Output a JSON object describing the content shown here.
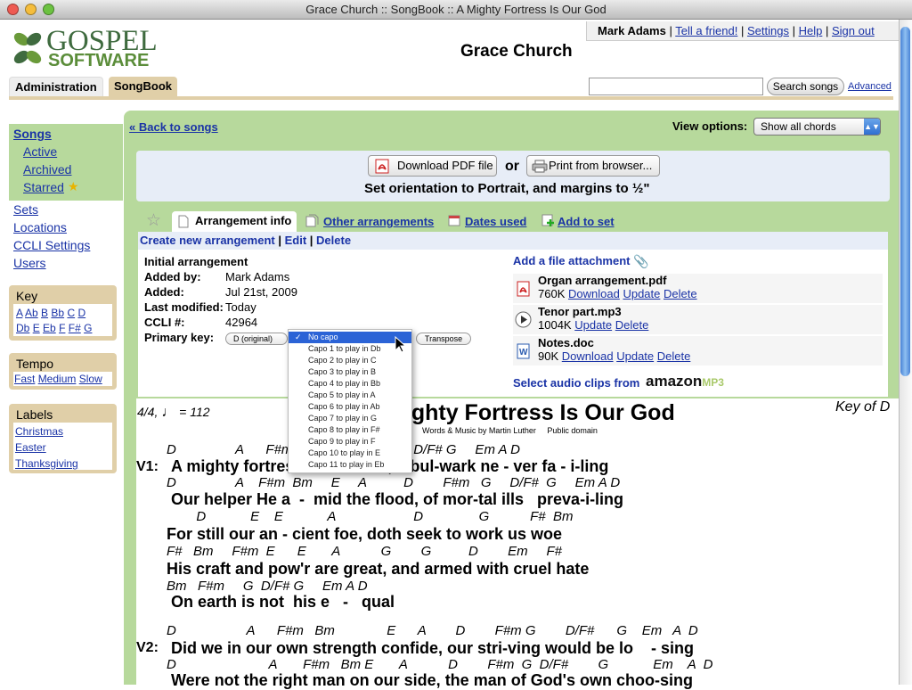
{
  "window": {
    "title": "Grace Church :: SongBook :: A Mighty Fortress Is Our God"
  },
  "logo": {
    "word1": "GOSPEL",
    "word2": "SOFTWARE"
  },
  "usernav": {
    "user": "Mark Adams",
    "links": [
      "Tell a friend!",
      "Settings",
      "Help",
      "Sign out"
    ],
    "sep": "|"
  },
  "church_name": "Grace Church",
  "tabs": {
    "admin": "Administration",
    "songbook": "SongBook"
  },
  "search": {
    "value": "",
    "button": "Search songs",
    "advanced": "Advanced"
  },
  "sidebar": {
    "songs": "Songs",
    "songs_sub": [
      "Active",
      "Archived",
      "Starred"
    ],
    "links": [
      "Sets",
      "Locations",
      "CCLI Settings",
      "Users"
    ],
    "key": {
      "title": "Key",
      "row1": [
        "A",
        "Ab",
        "B",
        "Bb",
        "C",
        "D"
      ],
      "row2": [
        "Db",
        "E",
        "Eb",
        "F",
        "F#",
        "G"
      ]
    },
    "tempo": {
      "title": "Tempo",
      "items": [
        "Fast",
        "Medium",
        "Slow"
      ]
    },
    "labels": {
      "title": "Labels",
      "items": [
        "Christmas",
        "Easter",
        "Thanksgiving"
      ]
    }
  },
  "main": {
    "back": "« Back to songs",
    "view_options_label": "View options:",
    "view_option_value": "Show all chords",
    "download_pdf": "Download PDF file",
    "or": "or",
    "print": "Print from browser...",
    "orientation": "Set orientation to Portrait, and margins to ½\"",
    "tabs": [
      "Arrangement info",
      "Other arrangements",
      "Dates used",
      "Add to set"
    ],
    "actions": [
      "Create new arrangement",
      "Edit",
      "Delete"
    ],
    "info": {
      "title": "Initial arrangement",
      "added_by_label": "Added by:",
      "added_by": "Mark Adams",
      "added_label": "Added:",
      "added": "Jul 21st, 2009",
      "modified_label": "Last modified:",
      "modified": "Today",
      "ccli_label": "CCLI #:",
      "ccli": "42964",
      "key_label": "Primary key:",
      "key_value": "D (original)",
      "transpose": "Transpose"
    },
    "capo_options": [
      "No capo",
      "Capo 1 to play in Db",
      "Capo 2 to play in C",
      "Capo 3 to play in B",
      "Capo 4 to play in Bb",
      "Capo 5 to play in A",
      "Capo 6 to play in Ab",
      "Capo 7 to play in G",
      "Capo 8 to play in F#",
      "Capo 9 to play in F",
      "Capo 10 to play in E",
      "Capo 11 to play in Eb"
    ],
    "attachments": {
      "add": "Add a file attachment",
      "files": [
        {
          "name": "Organ arrangement.pdf",
          "size": "760K",
          "links": [
            "Download",
            "Update",
            "Delete"
          ]
        },
        {
          "name": "Tenor part.mp3",
          "size": "1004K",
          "links": [
            "Update",
            "Delete"
          ]
        },
        {
          "name": "Notes.doc",
          "size": "90K",
          "links": [
            "Download",
            "Update",
            "Delete"
          ]
        }
      ],
      "audio": "Select audio clips from",
      "amazon": "amazon",
      "mp3": "MP3"
    }
  },
  "song": {
    "tempo": "4/4,",
    "bpm": "= 112",
    "title": "A Mighty Fortress Is Our God",
    "credits": "Words & Music by Martin Luther",
    "rights": "Public domain",
    "key": "Key of D",
    "v1": "V1:",
    "v2": "V2:",
    "lines": [
      {
        "chords": "D                A      F#m           D F#m G       D/F# G     Em A D",
        "lyric": "A mighty fortress is our God, a bul-wark ne - ver fa - i-ling"
      },
      {
        "chords": "D                A    F#m  Bm     E     A          D        F#m   G     D/F#  G     Em A D",
        "lyric": "Our helper He a  -  mid the flood, of mor-tal ills   preva-i-ling"
      },
      {
        "chords": "        D            E    E            A                     D               G           F#  Bm",
        "lyric": "For still our an - cient foe, doth seek to work us woe"
      },
      {
        "chords": "F#   Bm     F#m  E      E       A           G        G          D        Em     F#",
        "lyric": "His craft and pow'r are great, and armed with cruel hate"
      },
      {
        "chords": "Bm   F#m     G  D/F# G     Em A D",
        "lyric": "On earth is not  his e   -   qual"
      },
      {
        "chords": "D                   A      F#m   Bm              E      A        D        F#m G        D/F#      G    Em   A  D",
        "lyric": "Did we in our own strength confide, our stri-ving would be lo    - sing"
      },
      {
        "chords": "D                         A       F#m   Bm E       A           D        F#m  G  D/F#        G            Em    A  D",
        "lyric": "Were not the right man on our side, the man of God's own choo-sing"
      }
    ]
  }
}
